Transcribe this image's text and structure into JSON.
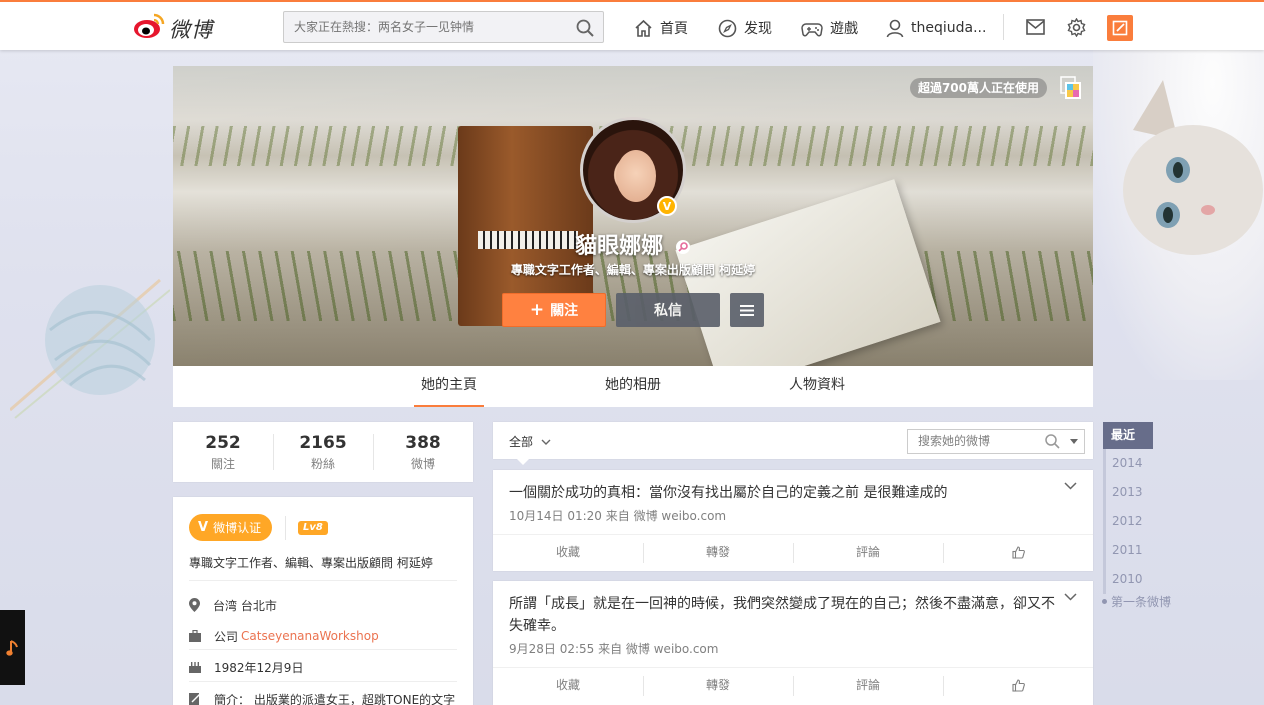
{
  "topbar": {
    "logo_text": "微博",
    "search_placeholder": "大家正在熱搜：两名女子一见钟情",
    "nav": [
      {
        "icon": "home-icon",
        "label": "首頁"
      },
      {
        "icon": "compass-icon",
        "label": "发现"
      },
      {
        "icon": "gamepad-icon",
        "label": "遊戲"
      },
      {
        "icon": "user-icon",
        "label": "theqiuda..."
      }
    ]
  },
  "cover": {
    "users_badge": "超過700萬人正在使用",
    "name": "貓眼娜娜",
    "description": "專職文字工作者、編輯、專案出版顧問 柯延婷",
    "verified_mark": "V",
    "follow_label": "關注",
    "message_label": "私信"
  },
  "tabs": [
    "她的主頁",
    "她的相册",
    "人物資料"
  ],
  "stats": [
    {
      "num": "252",
      "label": "關注"
    },
    {
      "num": "2165",
      "label": "粉絲"
    },
    {
      "num": "388",
      "label": "微博"
    }
  ],
  "info": {
    "verify_label": "微博认证",
    "level": "Lv8",
    "description": "專職文字工作者、編輯、專案出版顧問 柯延婷",
    "location": "台湾 台北市",
    "company_prefix": "公司",
    "company": "CatseyenanaWorkshop",
    "birthday": "1982年12月9日",
    "bio": "簡介：  出版業的派遣女王，超跳TONE的文字"
  },
  "feed": {
    "filter_label": "全部",
    "search_placeholder": "搜索她的微博",
    "posts": [
      {
        "text": "一個關於成功的真相：當你沒有找出屬於自己的定義之前 是很難達成的",
        "meta": "10月14日 01:20 来自 微博 weibo.com"
      },
      {
        "text": "所謂「成長」就是在一回神的時候，我們突然變成了現在的自己；然後不盡滿意，卻又不失確幸。",
        "meta": "9月28日 02:55 来自 微博 weibo.com"
      }
    ],
    "actions": [
      "收藏",
      "轉發",
      "評論"
    ]
  },
  "timeline": {
    "current": "最近",
    "years": [
      "2014",
      "2013",
      "2012",
      "2011",
      "2010"
    ],
    "first": "第一条微博"
  },
  "colors": {
    "accent": "#fa7d3c",
    "verify": "#ffa726",
    "link": "#eb7350",
    "timeline": "#676d8a"
  }
}
